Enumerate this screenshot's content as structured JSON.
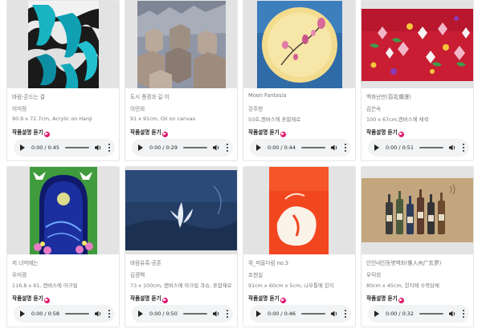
{
  "player": {
    "current_time": "0:00",
    "separator": " / ",
    "link_glyph": "▶"
  },
  "artworks": [
    {
      "title": "바람-흔드는 결",
      "artist": "이미정",
      "spec": "90.9 x 72.7cm, Acrylic on Hanji",
      "link": "작품설명 듣기",
      "duration": "0:45"
    },
    {
      "title": "도시 풍경과 길 어",
      "artist": "이민희",
      "spec": "91 x 91cm, Oil on canvas",
      "link": "작품설명 듣기",
      "duration": "0:29"
    },
    {
      "title": "Moon Fantasia",
      "artist": "강주현",
      "spec": "50호,캔버스에 혼합재료",
      "link": "작품설명 듣기",
      "duration": "0:44"
    },
    {
      "title": "백화난만(百花爛漫)",
      "artist": "김은숙",
      "spec": "100 x 67cm,캔버스에 채색",
      "link": "작품설명 듣기",
      "duration": "0:51"
    },
    {
      "title": "저 너머에는",
      "artist": "우미경",
      "spec": "116.8 x 91, 캔버스에 아크릴",
      "link": "작품설명 듣기",
      "duration": "0:58"
    },
    {
      "title": "바람유혹-공존",
      "artist": "김경백",
      "spec": "73 x 100cm, 캔버스에 아크릴 과슈, 혼합재료",
      "link": "작품설명 듣기",
      "duration": "0:50"
    },
    {
      "title": "위_떠올다림 no.3",
      "artist": "조현실",
      "spec": "91cm x 60cm x 5cm, 나무틀에 한지",
      "link": "작품설명 듣기",
      "duration": "0:46"
    },
    {
      "title": "인인내인동병백화(惟人內广玄夢)",
      "artist": "우덕희",
      "spec": "80cm x 45cm, 한지에 수묵담채",
      "link": "작품설명 듣기",
      "duration": "0:32"
    }
  ]
}
